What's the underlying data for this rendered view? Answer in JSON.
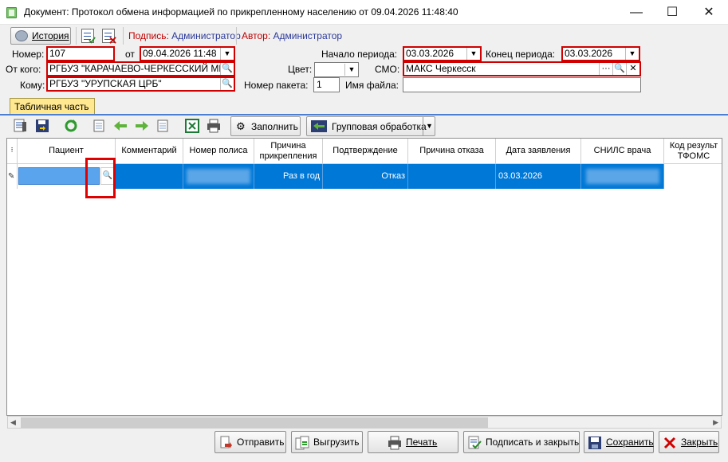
{
  "window": {
    "title": "Документ: Протокол обмена информацией по прикрепленному населению от 09.04.2026 11:48:40",
    "minimize": "—",
    "maximize": "☐",
    "close": "✕"
  },
  "toolbar": {
    "history_label": "История",
    "signature_label": "Подпись:",
    "signature_value": "Администратор",
    "author_label": "Автор:",
    "author_value": "Администратор"
  },
  "form": {
    "number_label": "Номер:",
    "number_value": "107",
    "date_label": "от",
    "date_value": "09.04.2026 11:48",
    "from_label": "От кого:",
    "from_value": "РГБУЗ \"КАРАЧАЕВО-ЧЕРКЕССКИЙ МНО",
    "to_label": "Кому:",
    "to_value": "РГБУЗ \"УРУПСКАЯ ЦРБ\"",
    "period_start_label": "Начало периода:",
    "period_start_value": "03.03.2026",
    "period_end_label": "Конец периода:",
    "period_end_value": "03.03.2026",
    "color_label": "Цвет:",
    "smo_label": "СМО:",
    "smo_value": "МАКС Черкесск",
    "packet_label": "Номер пакета:",
    "packet_value": "1",
    "filename_label": "Имя файла:",
    "filename_value": ""
  },
  "tab": {
    "label": "Табличная часть"
  },
  "grid_toolbar": {
    "fill_label": "Заполнить",
    "group_label": "Групповая обработка"
  },
  "grid": {
    "columns": [
      "Пациент",
      "Комментарий",
      "Номер полиса",
      "Причина прикрепления",
      "Подтверждение",
      "Причина отказа",
      "Дата заявления",
      "СНИЛС врача",
      "Код результ ТФОМС"
    ],
    "row": {
      "reason": "Раз в год",
      "confirmation": "Отказ",
      "refusal_reason": "",
      "date": "03.03.2026"
    }
  },
  "footer": {
    "send": "Отправить",
    "export": "Выгрузить",
    "print": "Печать",
    "sign_close": "Подписать и закрыть",
    "save": "Сохранить",
    "close": "Закрыть"
  },
  "colors": {
    "accent": "#0078d7",
    "required_border": "#d00000",
    "tab_bg": "#ffe890",
    "link_blue": "#2c3a9a"
  }
}
